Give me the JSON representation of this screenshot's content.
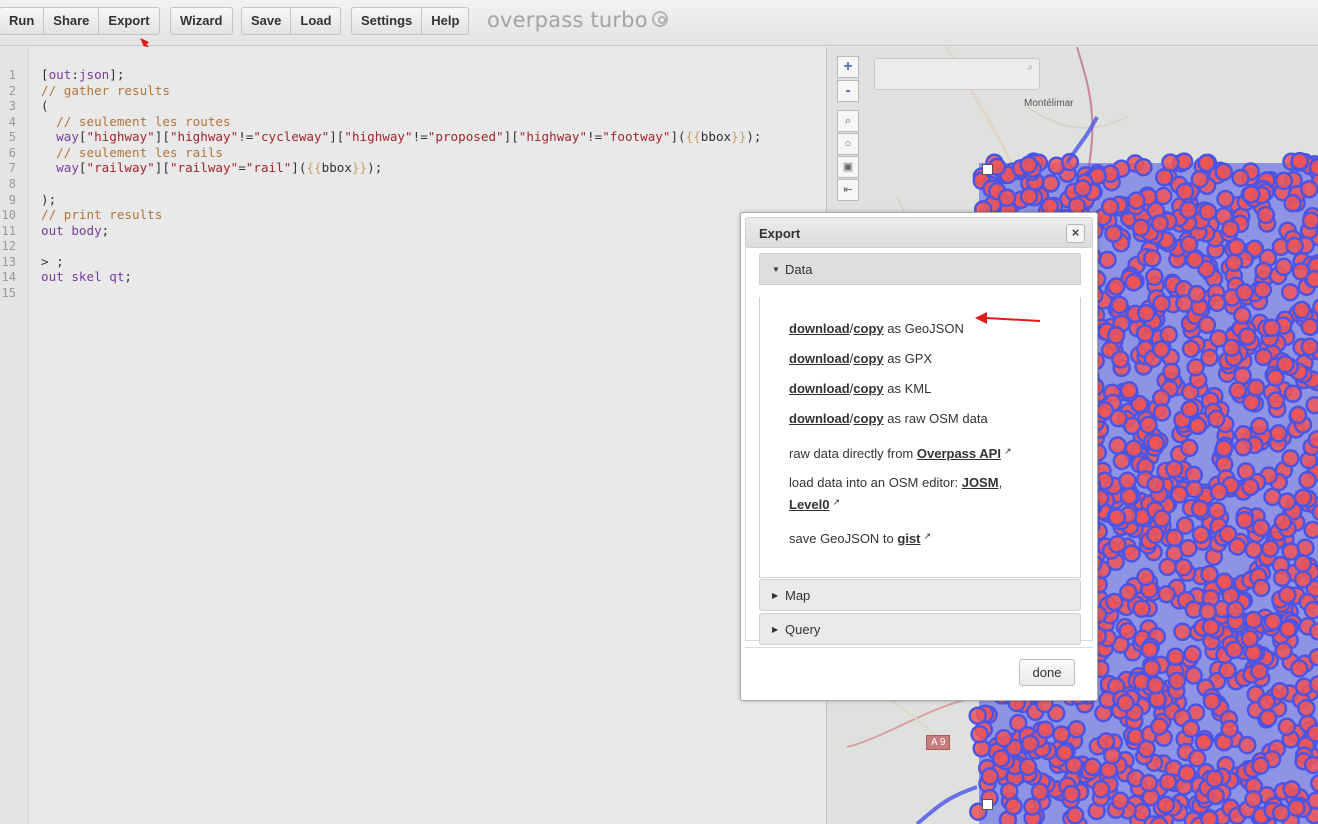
{
  "toolbar": {
    "group1": [
      "Run",
      "Share",
      "Export"
    ],
    "group2": [
      "Wizard"
    ],
    "group3": [
      "Save",
      "Load"
    ],
    "group4": [
      "Settings",
      "Help"
    ],
    "brand": "overpass turbo"
  },
  "editor": {
    "line_numbers": [
      "1",
      "2",
      "3",
      "4",
      "5",
      "6",
      "7",
      "8",
      "9",
      "10",
      "11",
      "12",
      "13",
      "14",
      "15"
    ]
  },
  "map": {
    "zoom_in": "+",
    "zoom_out": "-",
    "place_label": "Montélimar",
    "road_label": "A 9",
    "tool_icons": [
      "magnifier-icon",
      "circle-icon",
      "target-icon",
      "fit-bounds-icon"
    ],
    "data_colors": {
      "stroke": "#4a55e6",
      "fill": "#f05555"
    }
  },
  "dialog": {
    "title": "Export",
    "close": "×",
    "sections": {
      "data": "Data",
      "map": "Map",
      "query": "Query"
    },
    "rows": [
      {
        "download": "download",
        "sep": "/",
        "copy": "copy",
        "suffix": " as GeoJSON"
      },
      {
        "download": "download",
        "sep": "/",
        "copy": "copy",
        "suffix": " as GPX"
      },
      {
        "download": "download",
        "sep": "/",
        "copy": "copy",
        "suffix": " as KML"
      },
      {
        "download": "download",
        "sep": "/",
        "copy": "copy",
        "suffix": " as raw OSM data"
      }
    ],
    "raw_prefix": "raw data directly from ",
    "raw_link": "Overpass API",
    "editor_prefix": "load data into an OSM editor: ",
    "editor_link1": "JOSM",
    "editor_sep": ",",
    "editor_link2": "Level0",
    "gist_prefix": "save GeoJSON to ",
    "gist_link": "gist",
    "done": "done"
  }
}
